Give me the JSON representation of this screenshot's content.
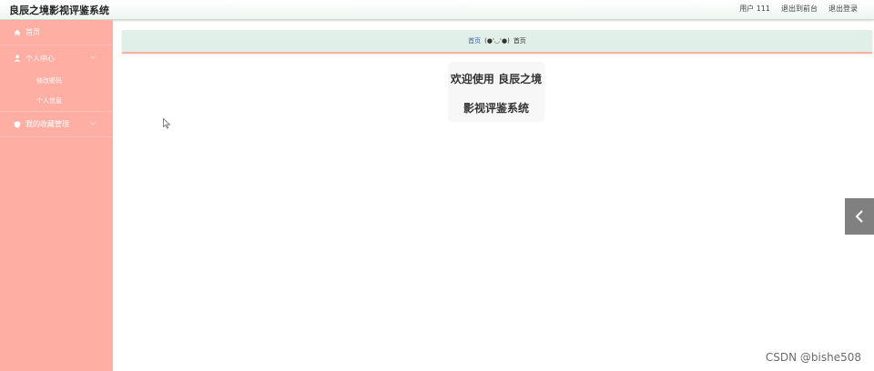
{
  "header": {
    "app_title": "良辰之境影视评鉴系统",
    "user_label": "用户 111",
    "front_link": "退出到前台",
    "logout_link": "退出登录"
  },
  "sidebar": {
    "home": "首页",
    "personal_center": "个人中心",
    "change_password": "修改密码",
    "personal_info": "个人信息",
    "my_favorites": "我的收藏管理"
  },
  "breadcrumb": {
    "home": "首页",
    "emoticon": "(●'◡'●)",
    "current": "首页"
  },
  "welcome": {
    "line1": "欢迎使用 良辰之境",
    "line2": "影视评鉴系统"
  },
  "watermark": "CSDN @bishe508",
  "colors": {
    "sidebar_bg": "#ffaea3",
    "breadcrumb_bg": "#e1efe9",
    "toggle_bg": "#808080"
  }
}
